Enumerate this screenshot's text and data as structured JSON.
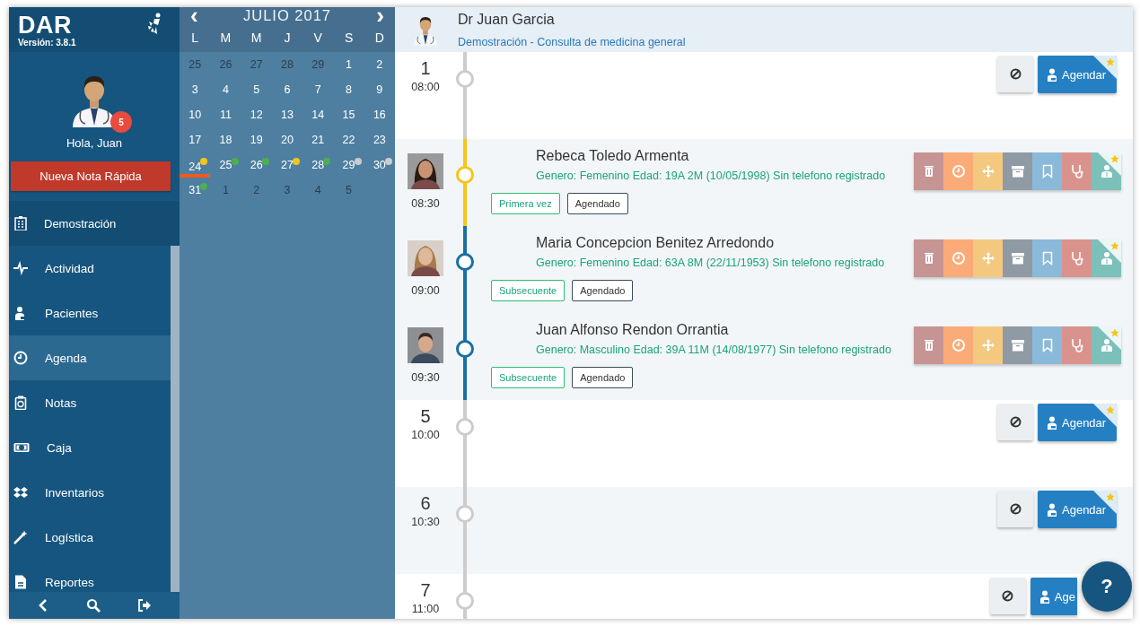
{
  "sidebar": {
    "logo": "DAR",
    "version": "Versión: 3.8.1",
    "badge": "5",
    "greeting": "Hola, Juan",
    "quick_note_button": "Nueva Nota Rápida",
    "clinic": "Demostración",
    "items": [
      {
        "label": "Actividad",
        "selected": false
      },
      {
        "label": "Pacientes",
        "selected": false
      },
      {
        "label": "Agenda",
        "selected": true
      },
      {
        "label": "Notas",
        "selected": false
      },
      {
        "label": "Caja",
        "selected": false
      },
      {
        "label": "Inventarios",
        "selected": false
      },
      {
        "label": "Logística",
        "selected": false
      },
      {
        "label": "Reportes",
        "selected": false
      }
    ]
  },
  "calendar": {
    "prev": "‹",
    "month": "JULIO 2017",
    "next": "›",
    "weekdays": [
      "L",
      "M",
      "M",
      "J",
      "V",
      "S",
      "D"
    ],
    "weeks": [
      {
        "days": [
          {
            "day": "25",
            "in_month": false,
            "selected": false
          },
          {
            "day": "26",
            "in_month": false,
            "selected": false
          },
          {
            "day": "27",
            "in_month": false,
            "selected": false
          },
          {
            "day": "28",
            "in_month": false,
            "selected": false
          },
          {
            "day": "29",
            "in_month": false,
            "selected": false
          },
          {
            "day": "1",
            "in_month": true,
            "selected": false
          },
          {
            "day": "2",
            "in_month": true,
            "selected": false
          }
        ]
      },
      {
        "days": [
          {
            "day": "3",
            "in_month": true,
            "selected": false
          },
          {
            "day": "4",
            "in_month": true,
            "selected": false
          },
          {
            "day": "5",
            "in_month": true,
            "selected": false
          },
          {
            "day": "6",
            "in_month": true,
            "selected": false
          },
          {
            "day": "7",
            "in_month": true,
            "selected": false
          },
          {
            "day": "8",
            "in_month": true,
            "selected": false
          },
          {
            "day": "9",
            "in_month": true,
            "selected": false
          }
        ]
      },
      {
        "days": [
          {
            "day": "10",
            "in_month": true,
            "selected": false
          },
          {
            "day": "11",
            "in_month": true,
            "selected": false
          },
          {
            "day": "12",
            "in_month": true,
            "selected": false
          },
          {
            "day": "13",
            "in_month": true,
            "selected": false
          },
          {
            "day": "14",
            "in_month": true,
            "selected": false
          },
          {
            "day": "15",
            "in_month": true,
            "selected": false
          },
          {
            "day": "16",
            "in_month": true,
            "selected": false
          }
        ]
      },
      {
        "days": [
          {
            "day": "17",
            "in_month": true,
            "selected": false
          },
          {
            "day": "18",
            "in_month": true,
            "selected": false
          },
          {
            "day": "19",
            "in_month": true,
            "selected": false
          },
          {
            "day": "20",
            "in_month": true,
            "selected": false
          },
          {
            "day": "21",
            "in_month": true,
            "selected": false
          },
          {
            "day": "22",
            "in_month": true,
            "selected": false
          },
          {
            "day": "23",
            "in_month": true,
            "selected": false
          }
        ]
      },
      {
        "days": [
          {
            "day": "24",
            "in_month": true,
            "selected": true,
            "color": "#f5c518"
          },
          {
            "day": "25",
            "in_month": true,
            "selected": false,
            "color": "#4caf50"
          },
          {
            "day": "26",
            "in_month": true,
            "selected": false,
            "color": "#4caf50"
          },
          {
            "day": "27",
            "in_month": true,
            "selected": false,
            "color": "#f5c518"
          },
          {
            "day": "28",
            "in_month": true,
            "selected": false,
            "color": "#4caf50"
          },
          {
            "day": "29",
            "in_month": true,
            "selected": false,
            "color": "#cccccc"
          },
          {
            "day": "30",
            "in_month": true,
            "selected": false,
            "color": "#cccccc"
          }
        ]
      },
      {
        "days": [
          {
            "day": "31",
            "in_month": true,
            "selected": false,
            "color": "#4caf50"
          },
          {
            "day": "1",
            "in_month": false,
            "selected": false
          },
          {
            "day": "2",
            "in_month": false,
            "selected": false
          },
          {
            "day": "3",
            "in_month": false,
            "selected": false
          },
          {
            "day": "4",
            "in_month": false,
            "selected": false
          },
          {
            "day": "5",
            "in_month": false,
            "selected": false
          }
        ]
      }
    ]
  },
  "schedule": {
    "doctor": "Dr Juan Garcia",
    "subtitle": "Demostración - Consulta de medicina general",
    "slots": [
      {
        "kind": "free",
        "number": "1",
        "time": "08:00",
        "button": "Agendar"
      },
      {
        "kind": "appointment",
        "time": "08:30",
        "color": "#f5c518",
        "name": "Rebeca Toledo Armenta",
        "details": "Genero: Femenino Edad: 19A 2M (10/05/1998) Sin telefono registrado",
        "tags": [
          {
            "label": "Primera vez",
            "kind": "type"
          },
          {
            "label": "Agendado",
            "kind": "status"
          }
        ]
      },
      {
        "kind": "appointment",
        "time": "09:00",
        "color": "#1a6fa3",
        "name": "Maria Concepcion Benitez Arredondo",
        "details": "Genero: Femenino Edad: 63A 8M (22/11/1953) Sin telefono registrado",
        "tags": [
          {
            "label": "Subsecuente",
            "kind": "type"
          },
          {
            "label": "Agendado",
            "kind": "status"
          }
        ]
      },
      {
        "kind": "appointment",
        "time": "09:30",
        "color": "#1a6fa3",
        "name": "Juan Alfonso Rendon Orrantia",
        "details": "Genero: Masculino Edad: 39A 11M (14/08/1977) Sin telefono registrado",
        "tags": [
          {
            "label": "Subsecuente",
            "kind": "type"
          },
          {
            "label": "Agendado",
            "kind": "status"
          }
        ]
      },
      {
        "kind": "free",
        "number": "5",
        "time": "10:00",
        "button": "Agendar"
      },
      {
        "kind": "free",
        "number": "6",
        "time": "10:30",
        "button": "Agendar"
      },
      {
        "kind": "free",
        "number": "7",
        "time": "11:00",
        "button": "Age"
      }
    ],
    "help_button": "?"
  }
}
